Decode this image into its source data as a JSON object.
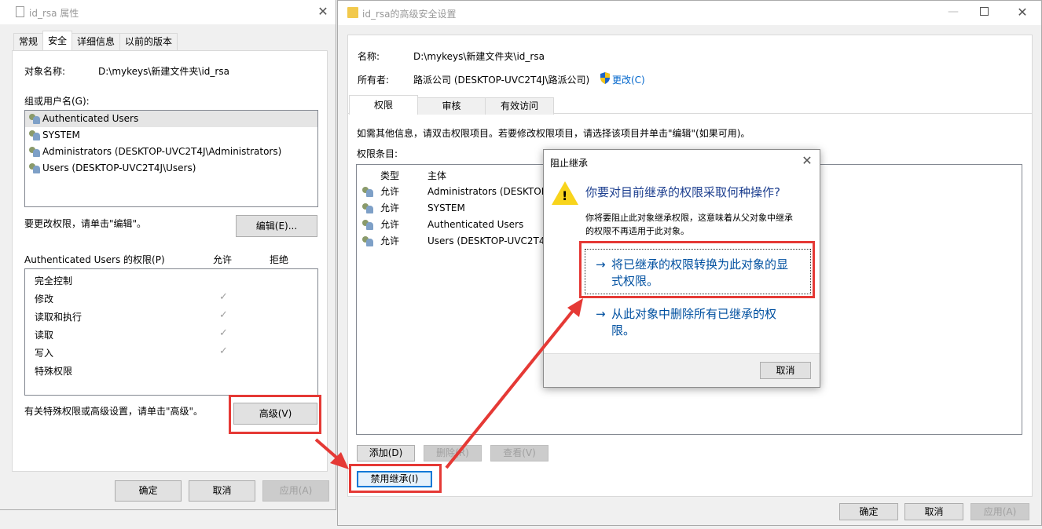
{
  "props": {
    "title": "id_rsa 属性",
    "tabs": [
      "常规",
      "安全",
      "详细信息",
      "以前的版本"
    ],
    "object_label": "对象名称:",
    "object_value": "D:\\mykeys\\新建文件夹\\id_rsa",
    "groups_label": "组或用户名(G):",
    "users": [
      "Authenticated Users",
      "SYSTEM",
      "Administrators (DESKTOP-UVC2T4J\\Administrators)",
      "Users (DESKTOP-UVC2T4J\\Users)"
    ],
    "edit_hint": "要更改权限，请单击\"编辑\"。",
    "edit_button": "编辑(E)...",
    "perms_label": "Authenticated Users 的权限(P)",
    "allow_header": "允许",
    "deny_header": "拒绝",
    "permissions": [
      {
        "name": "完全控制",
        "allow": false
      },
      {
        "name": "修改",
        "allow": true
      },
      {
        "name": "读取和执行",
        "allow": true
      },
      {
        "name": "读取",
        "allow": true
      },
      {
        "name": "写入",
        "allow": true
      },
      {
        "name": "特殊权限",
        "allow": false
      }
    ],
    "check_glyph": "✓",
    "advanced_hint": "有关特殊权限或高级设置，请单击\"高级\"。",
    "advanced_button": "高级(V)",
    "ok": "确定",
    "cancel": "取消",
    "apply": "应用(A)"
  },
  "adv": {
    "title": "id_rsa的高级安全设置",
    "name_label": "名称:",
    "name_value": "D:\\mykeys\\新建文件夹\\id_rsa",
    "owner_label": "所有者:",
    "owner_value": "路派公司 (DESKTOP-UVC2T4J\\路派公司)",
    "change_link": "更改(C)",
    "tabs": [
      "权限",
      "审核",
      "有效访问"
    ],
    "info": "如需其他信息，请双击权限项目。若要修改权限项目，请选择该项目并单击\"编辑\"(如果可用)。",
    "entries_label": "权限条目:",
    "col_type": "类型",
    "col_principal": "主体",
    "entries": [
      {
        "type": "允许",
        "principal": "Administrators (DESKTOP-"
      },
      {
        "type": "允许",
        "principal": "SYSTEM"
      },
      {
        "type": "允许",
        "principal": "Authenticated Users"
      },
      {
        "type": "允许",
        "principal": "Users (DESKTOP-UVC2T4."
      }
    ],
    "add": "添加(D)",
    "remove": "删除(R)",
    "view": "查看(V)",
    "disable_inherit": "禁用继承(I)",
    "ok": "确定",
    "cancel": "取消",
    "apply": "应用(A)"
  },
  "dialog": {
    "title": "阻止继承",
    "question": "你要对目前继承的权限采取何种操作?",
    "desc_line1": "你将要阻止此对象继承权限，这意味着从父对象中继承",
    "desc_line2": "的权限不再适用于此对象。",
    "option1_line1": "将已继承的权限转换为此对象的显",
    "option1_line2": "式权限。",
    "option2_line1": "从此对象中删除所有已继承的权",
    "option2_line2": "限。",
    "arrow_glyph": "→",
    "cancel": "取消"
  },
  "colors": {
    "accent": "#0078d7",
    "highlight": "#e53935",
    "link": "#0066cc"
  }
}
